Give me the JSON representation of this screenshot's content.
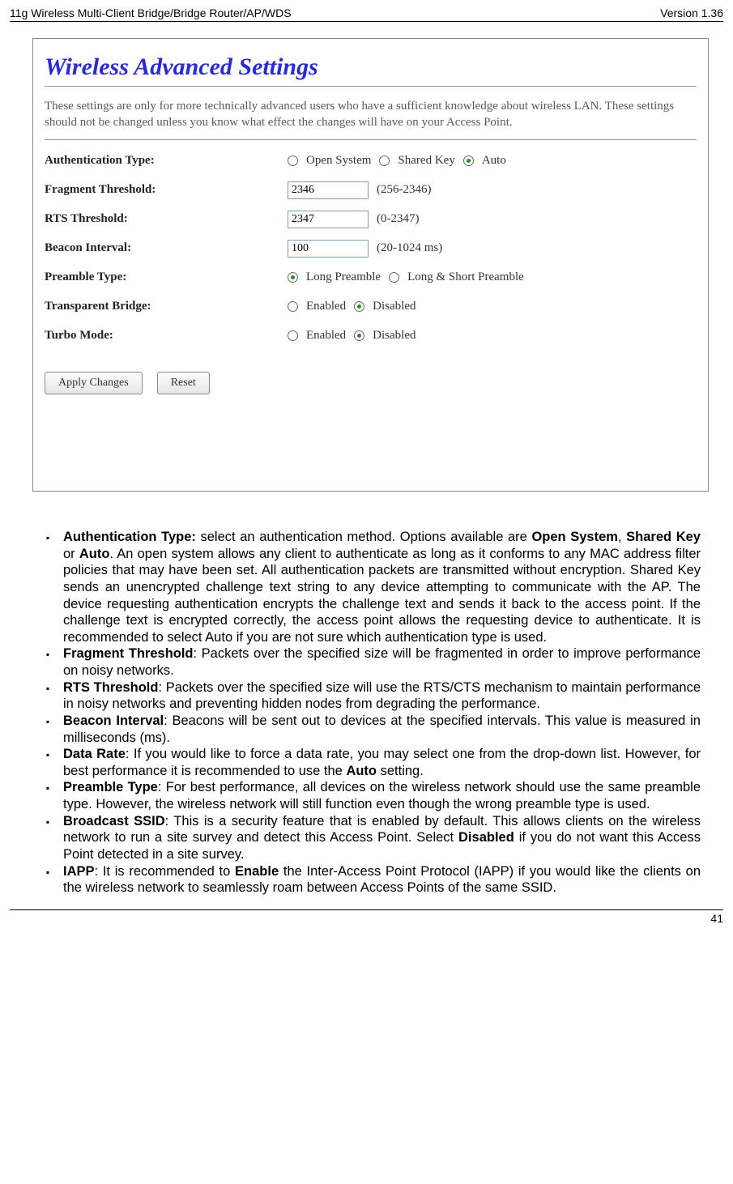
{
  "header": {
    "left": "11g Wireless Multi-Client Bridge/Bridge Router/AP/WDS",
    "right": "Version 1.36"
  },
  "screenshot": {
    "title": "Wireless Advanced Settings",
    "description": "These settings are only for more technically advanced users who have a sufficient knowledge about wireless LAN. These settings should not be changed unless you know what effect the changes will have on your Access Point.",
    "rows": {
      "auth": {
        "label": "Authentication Type:",
        "opts": [
          "Open System",
          "Shared Key",
          "Auto"
        ]
      },
      "frag": {
        "label": "Fragment Threshold:",
        "value": "2346",
        "hint": "(256-2346)"
      },
      "rts": {
        "label": "RTS Threshold:",
        "value": "2347",
        "hint": "(0-2347)"
      },
      "beacon": {
        "label": "Beacon Interval:",
        "value": "100",
        "hint": "(20-1024 ms)"
      },
      "preamble": {
        "label": "Preamble Type:",
        "opts": [
          "Long Preamble",
          "Long & Short Preamble"
        ]
      },
      "tbridge": {
        "label": "Transparent Bridge:",
        "opts": [
          "Enabled",
          "Disabled"
        ]
      },
      "turbo": {
        "label": "Turbo Mode:",
        "opts": [
          "Enabled",
          "Disabled"
        ]
      }
    },
    "buttons": {
      "apply": "Apply Changes",
      "reset": "Reset"
    }
  },
  "bullets": {
    "auth": {
      "lead": "Authentication Type:",
      "mid1": " select an authentication method. Options available are ",
      "b1": "Open System",
      "comma": ", ",
      "b2": "Shared Key",
      "or": " or ",
      "b3": "Auto",
      "tail": ". An open system allows any client to authenticate as long as it conforms to any MAC address filter policies that may have been set. All authentication packets are transmitted without encryption. Shared Key sends an unencrypted challenge text string to any device attempting to communicate with the AP. The device requesting authentication encrypts the challenge text and sends it back to the access point. If the challenge text is encrypted correctly, the access point allows the requesting device to authenticate. It is recommended to select Auto if you are not sure which authentication type is used."
    },
    "frag": {
      "lead": "Fragment Threshold",
      "tail": ": Packets over the specified size will be fragmented in order to improve performance on noisy networks."
    },
    "rts": {
      "lead": "RTS Threshold",
      "tail": ": Packets over the specified size will use the RTS/CTS mechanism to maintain performance in noisy networks and preventing hidden nodes from degrading the performance."
    },
    "beacon": {
      "lead": "Beacon Interval",
      "tail": ": Beacons will be sent out to devices at the specified intervals. This value is measured in milliseconds (ms)."
    },
    "rate": {
      "lead": "Data Rate",
      "mid": ": If you would like to force a data rate, you may select one from the drop-down list. However, for best performance it is recommended to use the ",
      "b1": "Auto",
      "tail": " setting."
    },
    "preamble": {
      "lead": "Preamble Type",
      "tail": ": For best performance, all devices on the wireless network should use the same preamble type. However, the wireless network will still function even though the wrong preamble type is used."
    },
    "bcast": {
      "lead": "Broadcast SSID",
      "mid": ": This is a security feature that is enabled by default. This allows clients on the wireless network to run a site survey and detect this Access Point. Select ",
      "b1": "Disabled",
      "tail": " if you do not want this Access Point detected in a site survey."
    },
    "iapp": {
      "lead": "IAPP",
      "mid": ": It is recommended to ",
      "b1": "Enable",
      "tail": " the Inter-Access Point Protocol (IAPP) if you would like the clients on the wireless network to seamlessly roam between Access Points of the same SSID."
    }
  },
  "pageNumber": "41"
}
